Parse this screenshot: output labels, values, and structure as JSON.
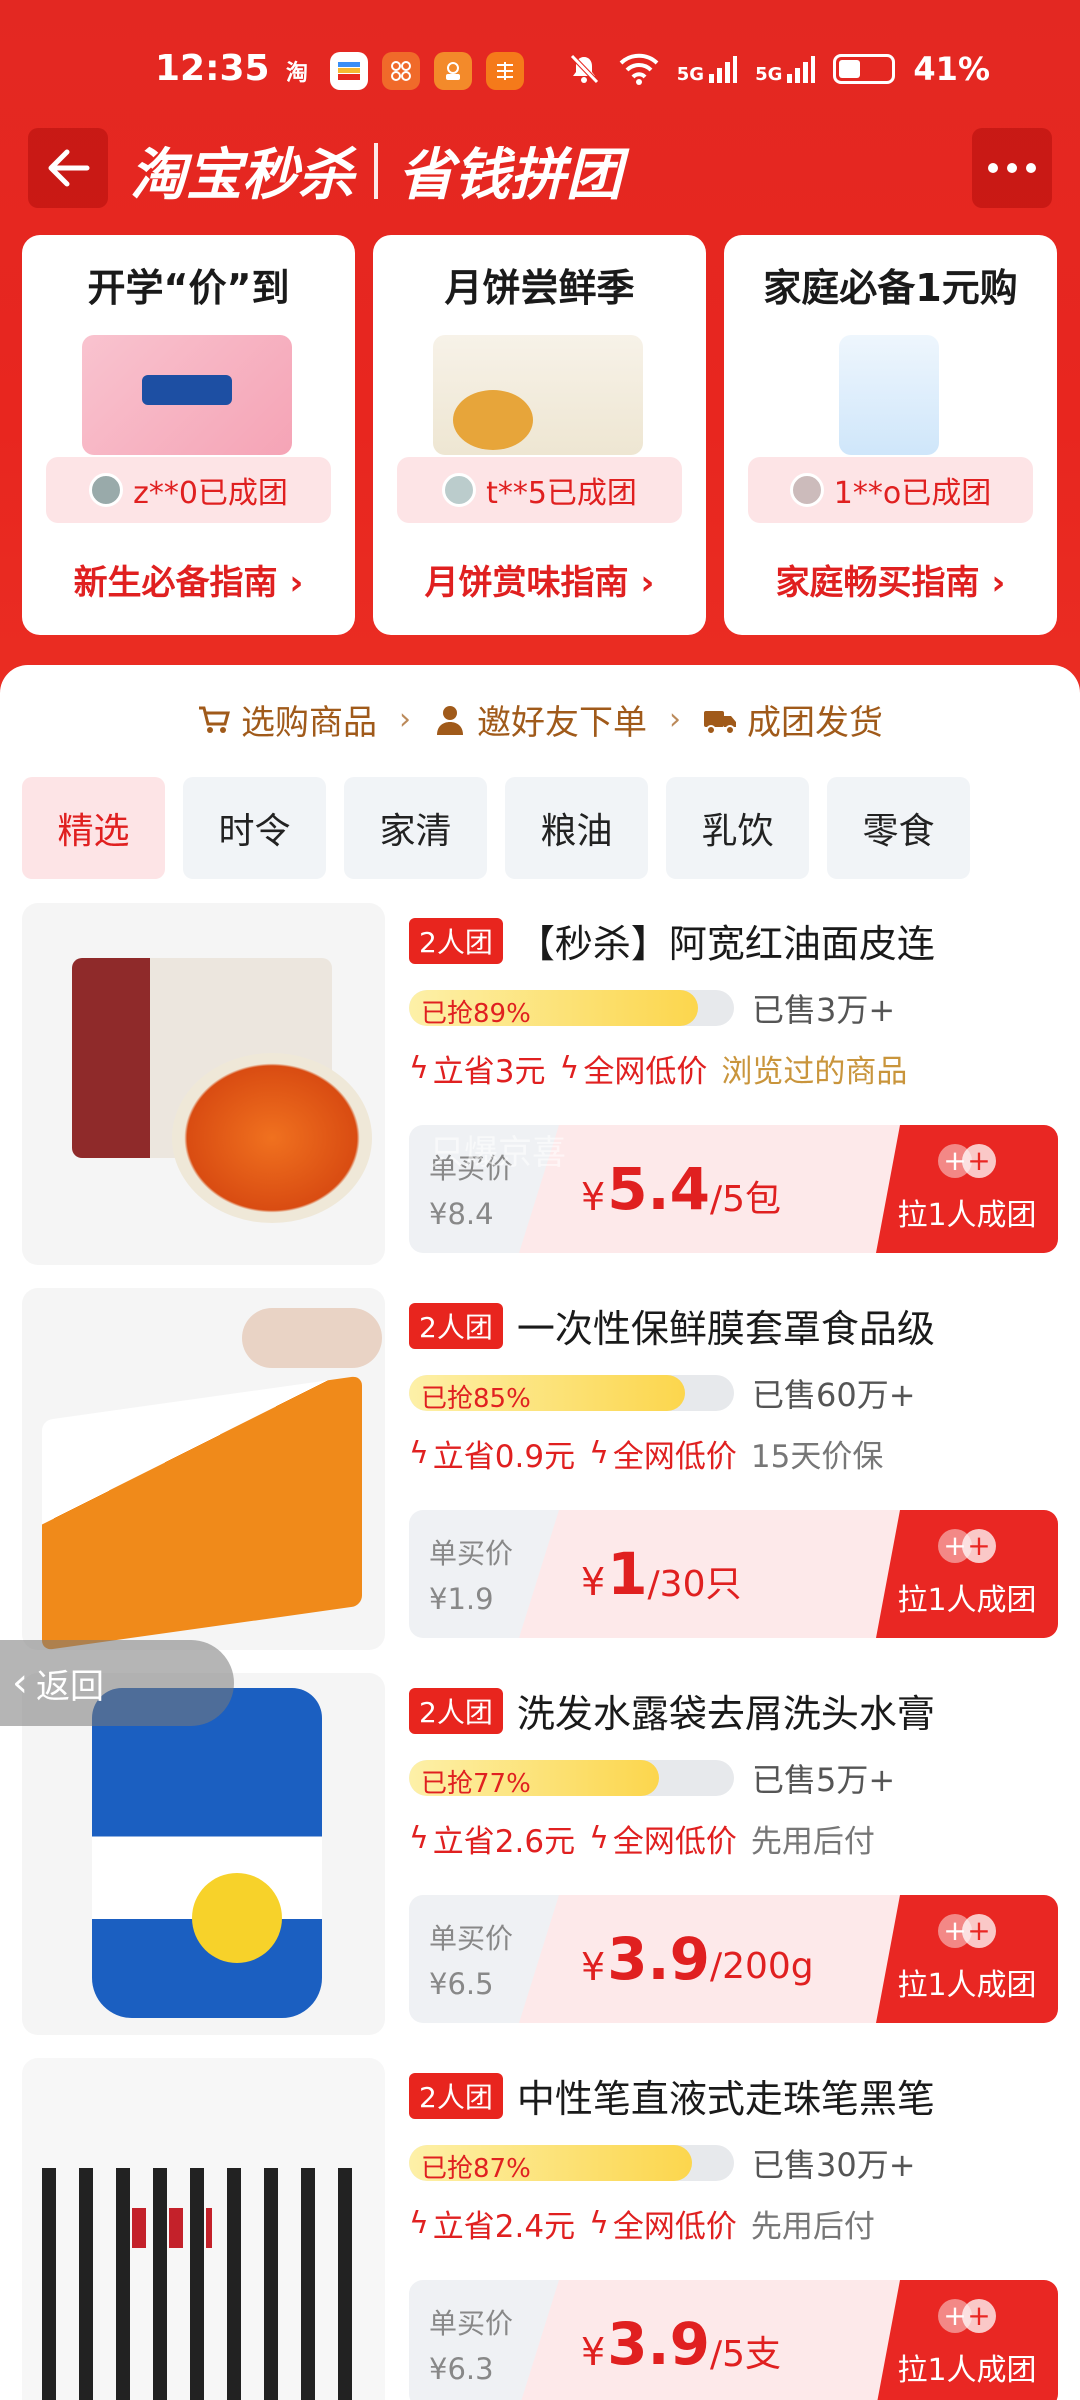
{
  "status_bar": {
    "time": "12:35",
    "apps": [
      "淘",
      "",
      "",
      "",
      ""
    ],
    "signal_labels": [
      "5G",
      "5G"
    ],
    "battery": "41%",
    "battery_level": 0.41
  },
  "header": {
    "brand_left": "淘宝秒杀",
    "brand_right": "省钱拼团"
  },
  "promos": [
    {
      "title": "开学“价”到",
      "joined": "z**0已成团",
      "guide": "新生必备指南"
    },
    {
      "title": "月饼尝鲜季",
      "joined": "t**5已成团",
      "guide": "月饼赏味指南"
    },
    {
      "title": "家庭必备1元购",
      "joined": "1**o已成团",
      "guide": "家庭畅买指南"
    }
  ],
  "steps": [
    "选购商品",
    "邀好友下单",
    "成团发货"
  ],
  "tabs": [
    "精选",
    "时令",
    "家清",
    "粮油",
    "乳饮",
    "零食"
  ],
  "watermark": "只爆京喜",
  "products": [
    {
      "badge": "2人团",
      "title": "【秒杀】阿宽红油面皮连",
      "progress": 0.89,
      "progress_text": "已抢89%",
      "sold": "已售3万+",
      "save": "立省3元",
      "lowest": "全网低价",
      "extra": "浏览过的商品",
      "single_label": "单买价",
      "single_price": "¥8.4",
      "yen": "¥",
      "price": "5.4",
      "unit": "/5包",
      "cta": "拉1人成团"
    },
    {
      "badge": "2人团",
      "title": "一次性保鲜膜套罩食品级",
      "progress": 0.85,
      "progress_text": "已抢85%",
      "sold": "已售60万+",
      "save": "立省0.9元",
      "lowest": "全网低价",
      "extra": "15天价保",
      "single_label": "单买价",
      "single_price": "¥1.9",
      "yen": "¥",
      "price": "1",
      "unit": "/30只",
      "cta": "拉1人成团"
    },
    {
      "badge": "2人团",
      "title": "洗发水露袋去屑洗头水膏",
      "progress": 0.77,
      "progress_text": "已抢77%",
      "sold": "已售5万+",
      "save": "立省2.6元",
      "lowest": "全网低价",
      "extra": "先用后付",
      "single_label": "单买价",
      "single_price": "¥6.5",
      "yen": "¥",
      "price": "3.9",
      "unit": "/200g",
      "cta": "拉1人成团"
    },
    {
      "badge": "2人团",
      "title": "中性笔直液式走珠笔黑笔",
      "progress": 0.87,
      "progress_text": "已抢87%",
      "sold": "已售30万+",
      "save": "立省2.4元",
      "lowest": "全网低价",
      "extra": "先用后付",
      "single_label": "单买价",
      "single_price": "¥6.3",
      "yen": "¥",
      "price": "3.9",
      "unit": "/5支",
      "cta": "拉1人成团"
    }
  ],
  "float_back": "返回",
  "colors": {
    "brand_red": "#e8261f",
    "deal_red": "#e02020",
    "step_brown": "#a05a1a"
  }
}
